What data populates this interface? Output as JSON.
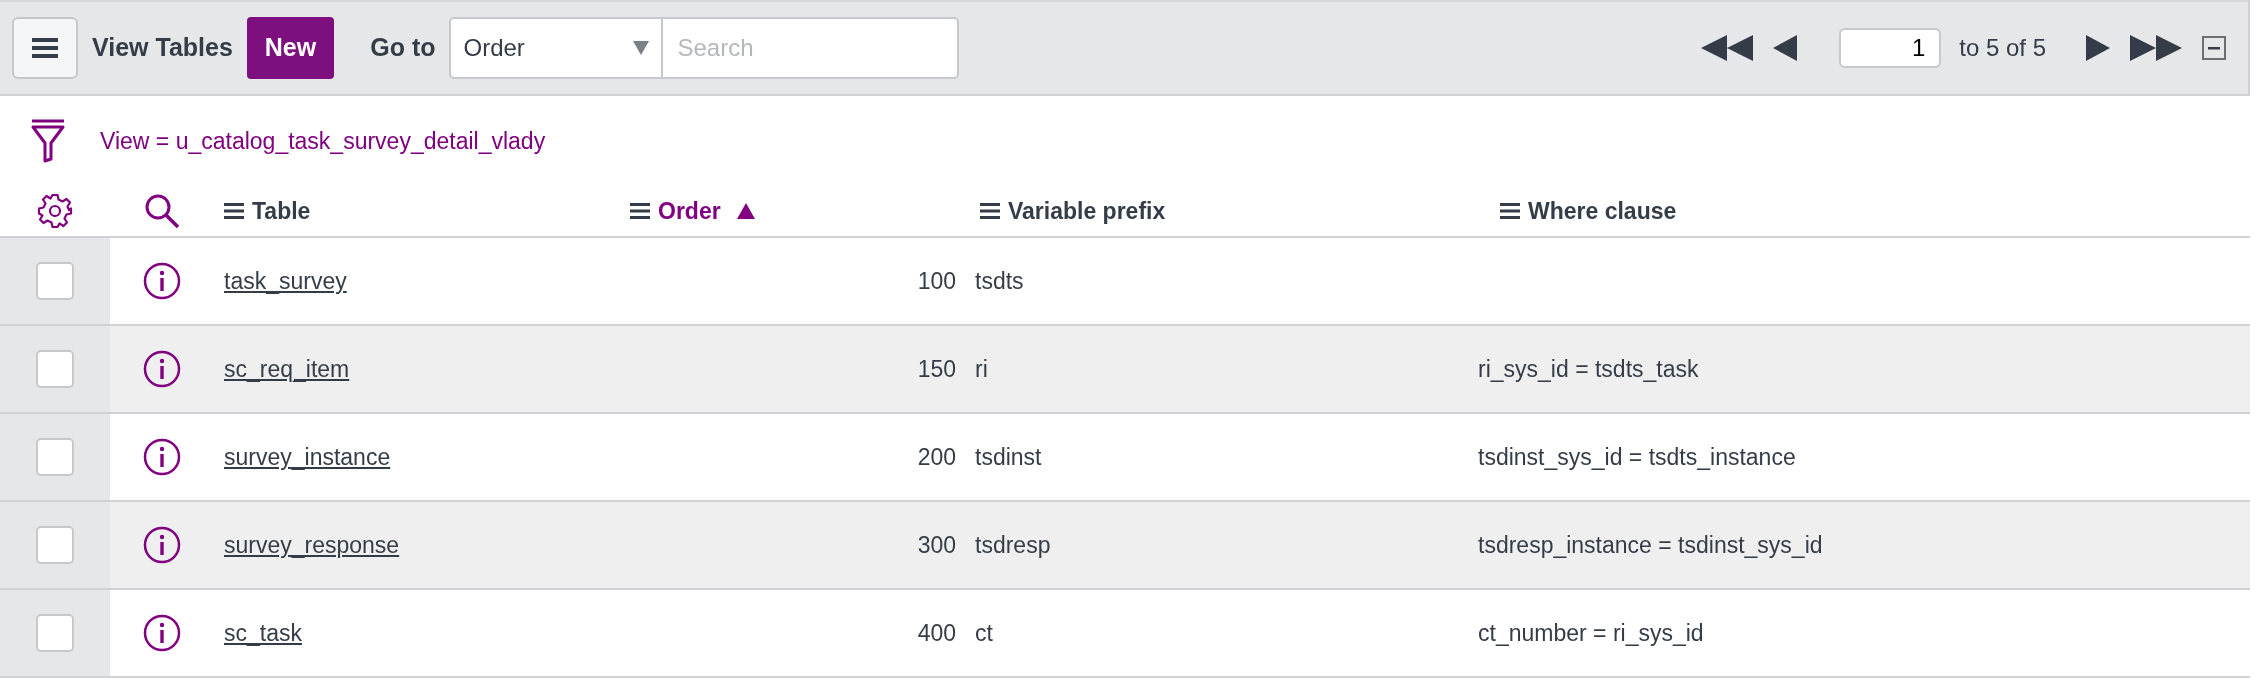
{
  "toolbar": {
    "title": "View Tables",
    "new_button": "New",
    "goto_label": "Go to",
    "goto_select": {
      "value": "Order"
    },
    "search": {
      "placeholder": "Search"
    }
  },
  "pagination": {
    "page": "1",
    "range": "to 5 of 5"
  },
  "filter": "View = u_catalog_task_survey_detail_vlady",
  "columns": [
    {
      "label": "Table",
      "sorted": false
    },
    {
      "label": "Order",
      "sorted": true
    },
    {
      "label": "Variable prefix",
      "sorted": false
    },
    {
      "label": "Where clause",
      "sorted": false
    }
  ],
  "rows": [
    {
      "checked": false,
      "table": "task_survey",
      "order": "100",
      "variable_prefix": "tsdts"
    },
    {
      "checked": false,
      "table": "sc_req_item",
      "order": "150",
      "variable_prefix": "ri",
      "where_clause": "ri_sys_id = tsdts_task"
    },
    {
      "checked": false,
      "table": "survey_instance",
      "order": "200",
      "variable_prefix": "tsdinst",
      "where_clause": "tsdinst_sys_id = tsdts_instance"
    },
    {
      "checked": false,
      "table": "survey_response",
      "order": "300",
      "variable_prefix": "tsdresp",
      "where_clause": "tsdresp_instance = tsdinst_sys_id"
    },
    {
      "checked": false,
      "table": "sc_task",
      "order": "400",
      "variable_prefix": "ct",
      "where_clause": "ct_number = ri_sys_id"
    }
  ]
}
